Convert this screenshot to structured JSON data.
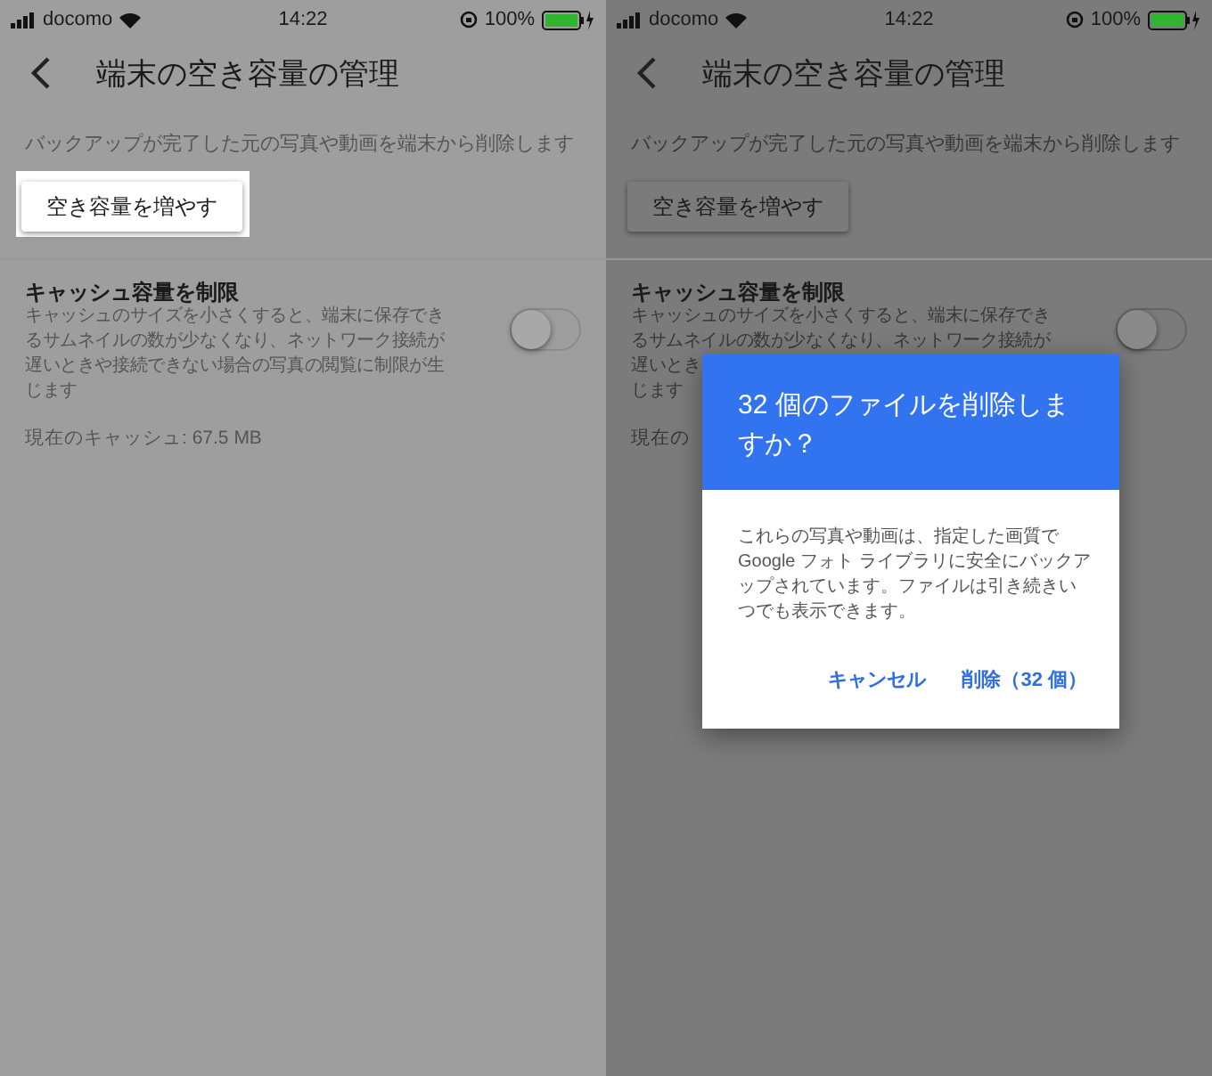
{
  "screens": [
    {
      "status_bar": {
        "carrier": "docomo",
        "time": "14:22",
        "battery": "100%"
      },
      "title": "端末の空き容量の管理",
      "description": "バックアップが完了した元の写真や動画を端末から削除します",
      "free_button": {
        "label": "空き容量を増やす",
        "highlighted": true
      },
      "cache": {
        "title": "キャッシュ容量を制限",
        "description_lines": [
          "キャッシュのサイズを小さくすると、端末に保存でき",
          "るサムネイルの数が少なくなり、ネットワーク接続が",
          "遅いときや接続できない場合の写真の閲覧に制限が生",
          "じます"
        ],
        "on": false,
        "current": "現在のキャッシュ: 67.5 MB"
      }
    },
    {
      "status_bar": {
        "carrier": "docomo",
        "time": "14:22",
        "battery": "100%"
      },
      "title": "端末の空き容量の管理",
      "description": "バックアップが完了した元の写真や動画を端末から削除します",
      "free_button": {
        "label": "空き容量を増やす",
        "highlighted": false
      },
      "cache": {
        "title": "キャッシュ容量を制限",
        "description_lines": [
          "キャッシュのサイズを小さくすると、端末に保存でき",
          "るサムネイルの数が少なくなり、ネットワーク接続が",
          "遅いとき",
          "じます"
        ],
        "on": false,
        "current": "現在の"
      },
      "dialog": {
        "title": "32 個のファイルを削除しますか？",
        "message": "これらの写真や動画は、指定した画質で Google フォト ライブラリに安全にバックアップされています。ファイルは引き続きいつでも表示できます。",
        "buttons": [
          "キャンセル",
          "削除（32 個）"
        ]
      }
    }
  ]
}
